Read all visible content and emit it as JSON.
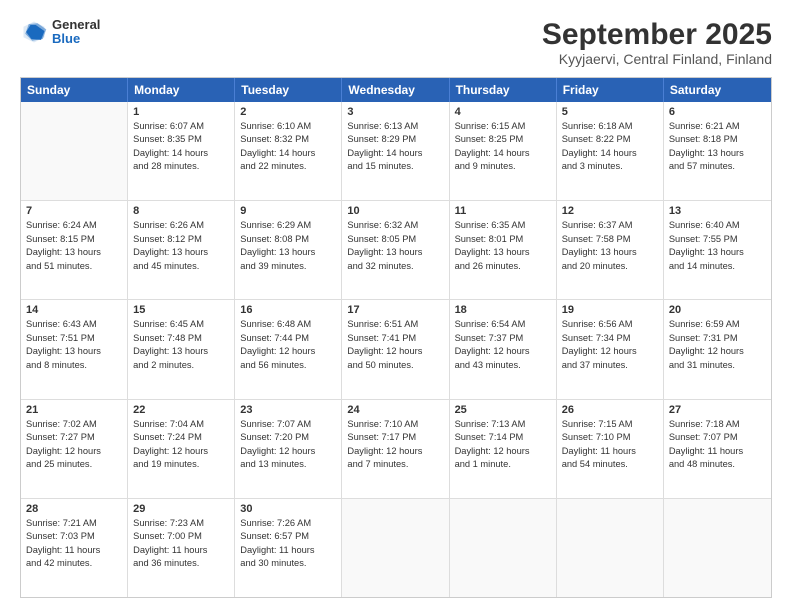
{
  "header": {
    "logo_general": "General",
    "logo_blue": "Blue",
    "title": "September 2025",
    "location": "Kyyjaervi, Central Finland, Finland"
  },
  "weekdays": [
    "Sunday",
    "Monday",
    "Tuesday",
    "Wednesday",
    "Thursday",
    "Friday",
    "Saturday"
  ],
  "rows": [
    [
      {
        "day": "",
        "lines": []
      },
      {
        "day": "1",
        "lines": [
          "Sunrise: 6:07 AM",
          "Sunset: 8:35 PM",
          "Daylight: 14 hours",
          "and 28 minutes."
        ]
      },
      {
        "day": "2",
        "lines": [
          "Sunrise: 6:10 AM",
          "Sunset: 8:32 PM",
          "Daylight: 14 hours",
          "and 22 minutes."
        ]
      },
      {
        "day": "3",
        "lines": [
          "Sunrise: 6:13 AM",
          "Sunset: 8:29 PM",
          "Daylight: 14 hours",
          "and 15 minutes."
        ]
      },
      {
        "day": "4",
        "lines": [
          "Sunrise: 6:15 AM",
          "Sunset: 8:25 PM",
          "Daylight: 14 hours",
          "and 9 minutes."
        ]
      },
      {
        "day": "5",
        "lines": [
          "Sunrise: 6:18 AM",
          "Sunset: 8:22 PM",
          "Daylight: 14 hours",
          "and 3 minutes."
        ]
      },
      {
        "day": "6",
        "lines": [
          "Sunrise: 6:21 AM",
          "Sunset: 8:18 PM",
          "Daylight: 13 hours",
          "and 57 minutes."
        ]
      }
    ],
    [
      {
        "day": "7",
        "lines": [
          "Sunrise: 6:24 AM",
          "Sunset: 8:15 PM",
          "Daylight: 13 hours",
          "and 51 minutes."
        ]
      },
      {
        "day": "8",
        "lines": [
          "Sunrise: 6:26 AM",
          "Sunset: 8:12 PM",
          "Daylight: 13 hours",
          "and 45 minutes."
        ]
      },
      {
        "day": "9",
        "lines": [
          "Sunrise: 6:29 AM",
          "Sunset: 8:08 PM",
          "Daylight: 13 hours",
          "and 39 minutes."
        ]
      },
      {
        "day": "10",
        "lines": [
          "Sunrise: 6:32 AM",
          "Sunset: 8:05 PM",
          "Daylight: 13 hours",
          "and 32 minutes."
        ]
      },
      {
        "day": "11",
        "lines": [
          "Sunrise: 6:35 AM",
          "Sunset: 8:01 PM",
          "Daylight: 13 hours",
          "and 26 minutes."
        ]
      },
      {
        "day": "12",
        "lines": [
          "Sunrise: 6:37 AM",
          "Sunset: 7:58 PM",
          "Daylight: 13 hours",
          "and 20 minutes."
        ]
      },
      {
        "day": "13",
        "lines": [
          "Sunrise: 6:40 AM",
          "Sunset: 7:55 PM",
          "Daylight: 13 hours",
          "and 14 minutes."
        ]
      }
    ],
    [
      {
        "day": "14",
        "lines": [
          "Sunrise: 6:43 AM",
          "Sunset: 7:51 PM",
          "Daylight: 13 hours",
          "and 8 minutes."
        ]
      },
      {
        "day": "15",
        "lines": [
          "Sunrise: 6:45 AM",
          "Sunset: 7:48 PM",
          "Daylight: 13 hours",
          "and 2 minutes."
        ]
      },
      {
        "day": "16",
        "lines": [
          "Sunrise: 6:48 AM",
          "Sunset: 7:44 PM",
          "Daylight: 12 hours",
          "and 56 minutes."
        ]
      },
      {
        "day": "17",
        "lines": [
          "Sunrise: 6:51 AM",
          "Sunset: 7:41 PM",
          "Daylight: 12 hours",
          "and 50 minutes."
        ]
      },
      {
        "day": "18",
        "lines": [
          "Sunrise: 6:54 AM",
          "Sunset: 7:37 PM",
          "Daylight: 12 hours",
          "and 43 minutes."
        ]
      },
      {
        "day": "19",
        "lines": [
          "Sunrise: 6:56 AM",
          "Sunset: 7:34 PM",
          "Daylight: 12 hours",
          "and 37 minutes."
        ]
      },
      {
        "day": "20",
        "lines": [
          "Sunrise: 6:59 AM",
          "Sunset: 7:31 PM",
          "Daylight: 12 hours",
          "and 31 minutes."
        ]
      }
    ],
    [
      {
        "day": "21",
        "lines": [
          "Sunrise: 7:02 AM",
          "Sunset: 7:27 PM",
          "Daylight: 12 hours",
          "and 25 minutes."
        ]
      },
      {
        "day": "22",
        "lines": [
          "Sunrise: 7:04 AM",
          "Sunset: 7:24 PM",
          "Daylight: 12 hours",
          "and 19 minutes."
        ]
      },
      {
        "day": "23",
        "lines": [
          "Sunrise: 7:07 AM",
          "Sunset: 7:20 PM",
          "Daylight: 12 hours",
          "and 13 minutes."
        ]
      },
      {
        "day": "24",
        "lines": [
          "Sunrise: 7:10 AM",
          "Sunset: 7:17 PM",
          "Daylight: 12 hours",
          "and 7 minutes."
        ]
      },
      {
        "day": "25",
        "lines": [
          "Sunrise: 7:13 AM",
          "Sunset: 7:14 PM",
          "Daylight: 12 hours",
          "and 1 minute."
        ]
      },
      {
        "day": "26",
        "lines": [
          "Sunrise: 7:15 AM",
          "Sunset: 7:10 PM",
          "Daylight: 11 hours",
          "and 54 minutes."
        ]
      },
      {
        "day": "27",
        "lines": [
          "Sunrise: 7:18 AM",
          "Sunset: 7:07 PM",
          "Daylight: 11 hours",
          "and 48 minutes."
        ]
      }
    ],
    [
      {
        "day": "28",
        "lines": [
          "Sunrise: 7:21 AM",
          "Sunset: 7:03 PM",
          "Daylight: 11 hours",
          "and 42 minutes."
        ]
      },
      {
        "day": "29",
        "lines": [
          "Sunrise: 7:23 AM",
          "Sunset: 7:00 PM",
          "Daylight: 11 hours",
          "and 36 minutes."
        ]
      },
      {
        "day": "30",
        "lines": [
          "Sunrise: 7:26 AM",
          "Sunset: 6:57 PM",
          "Daylight: 11 hours",
          "and 30 minutes."
        ]
      },
      {
        "day": "",
        "lines": []
      },
      {
        "day": "",
        "lines": []
      },
      {
        "day": "",
        "lines": []
      },
      {
        "day": "",
        "lines": []
      }
    ]
  ]
}
